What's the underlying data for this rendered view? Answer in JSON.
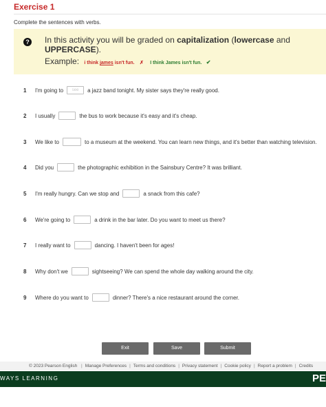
{
  "header": {
    "title": "Exercise 1"
  },
  "instruction": "Complete the sentences with verbs.",
  "notice": {
    "text_before": "In this activity you will be graded on ",
    "text_bold1": "capitalization",
    "text_paren_open": " (",
    "text_bold2": "lowercase",
    "text_and": " and ",
    "text_bold3": "UPPERCASE",
    "text_after": ").",
    "example_label": "Example:",
    "wrong_before": "i think ",
    "wrong_underlined": "james",
    "wrong_after": " isn't fun.",
    "wrong_mark": "✗",
    "correct": "I think James isn't fun.",
    "correct_mark": "✔"
  },
  "questions": [
    {
      "num": "1",
      "before": "I'm going to",
      "placeholder": "see",
      "after": "a jazz band tonight. My sister says they're really good."
    },
    {
      "num": "2",
      "before": "I usually",
      "placeholder": "",
      "after": "the bus to work because it's easy and it's cheap."
    },
    {
      "num": "3",
      "before": "We like to",
      "placeholder": "",
      "after": "to a museum at the weekend. You can learn new things, and it's better than watching television."
    },
    {
      "num": "4",
      "before": "Did you",
      "placeholder": "",
      "after": "the photographic exhibition in the Sainsbury Centre? It was brilliant."
    },
    {
      "num": "5",
      "before": "I'm really hungry. Can we stop and",
      "placeholder": "",
      "after": "a snack from this cafe?"
    },
    {
      "num": "6",
      "before": "We're going to",
      "placeholder": "",
      "after": "a drink in the bar later. Do you want to meet us there?"
    },
    {
      "num": "7",
      "before": "I really want to",
      "placeholder": "",
      "after": "dancing. I haven't been for ages!"
    },
    {
      "num": "8",
      "before": "Why don't we",
      "placeholder": "",
      "after": "sightseeing? We can spend the whole day walking around the city."
    },
    {
      "num": "9",
      "before": "Where do you want to",
      "placeholder": "",
      "after": "dinner? There's a nice restaurant around the corner."
    }
  ],
  "buttons": {
    "exit": "Exit",
    "save": "Save",
    "submit": "Submit"
  },
  "footer": {
    "copyright": "© 2023 Pearson English",
    "links": [
      "Manage Preferences",
      "Terms and conditions",
      "Privacy statement",
      "Cookie policy",
      "Report a problem",
      "Credits"
    ]
  },
  "brand": {
    "left": "WAYS LEARNING",
    "right": "PE"
  },
  "colors": {
    "title_red": "#c62828",
    "notice_bg": "#fbf7d4",
    "button_gray": "#6a6a6a",
    "brand_green": "#0b3d1f",
    "correct_green": "#2e7d32"
  }
}
